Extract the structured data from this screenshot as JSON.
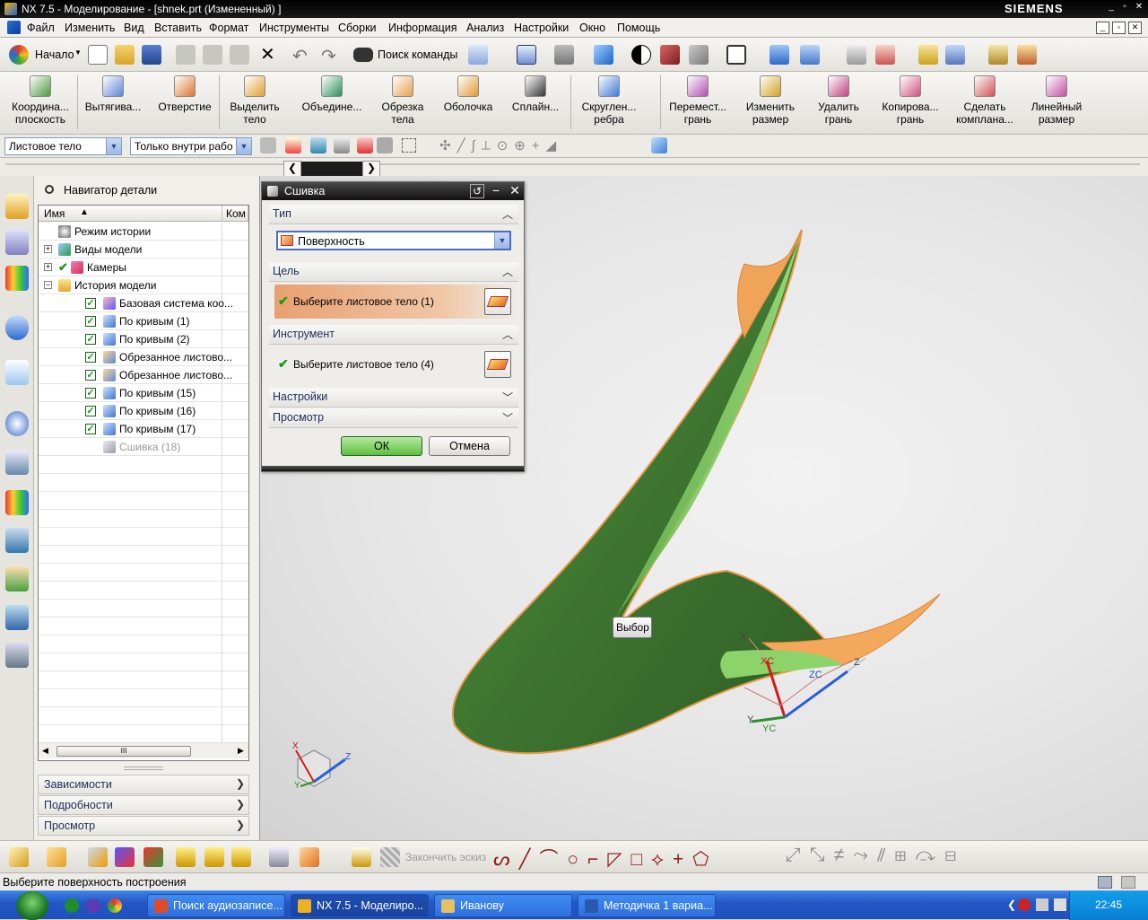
{
  "window": {
    "title": "NX 7.5 - Моделирование - [shnek.prt (Измененный) ]",
    "brand": "SIEMENS"
  },
  "menu": [
    "Файл",
    "Изменить",
    "Вид",
    "Вставить",
    "Формат",
    "Инструменты",
    "Сборки",
    "Информация",
    "Анализ",
    "Настройки",
    "Окно",
    "Помощь"
  ],
  "toolbar1": {
    "start_label": "Начало",
    "find_command_label": "Поиск команды"
  },
  "toolbar2": [
    {
      "line1": "Координа...",
      "line2": "плоскость",
      "icon": "datum-plane-icon",
      "color": "#4a9a3a"
    },
    {
      "line1": "Вытягива...",
      "line2": "",
      "icon": "extrude-icon",
      "color": "#5f84d6"
    },
    {
      "line1": "Отверстие",
      "line2": "",
      "icon": "hole-icon",
      "color": "#d9772a"
    },
    {
      "line1": "Выделить",
      "line2": "тело",
      "icon": "extract-body-icon",
      "color": "#e0a030"
    },
    {
      "line1": "Объедине...",
      "line2": "",
      "icon": "unite-icon",
      "color": "#2a8f5a"
    },
    {
      "line1": "Обрезка",
      "line2": "тела",
      "icon": "trim-body-icon",
      "color": "#e8a050"
    },
    {
      "line1": "Оболочка",
      "line2": "",
      "icon": "shell-icon",
      "color": "#e09a30"
    },
    {
      "line1": "Сплайн...",
      "line2": "",
      "icon": "spline-icon",
      "color": "#333333"
    },
    {
      "line1": "Скруглен...",
      "line2": "ребра",
      "icon": "edge-blend-icon",
      "color": "#3a78d6"
    },
    {
      "line1": "Перемест...",
      "line2": "грань",
      "icon": "move-face-icon",
      "color": "#b04fb0"
    },
    {
      "line1": "Изменить",
      "line2": "размер",
      "icon": "resize-face-icon",
      "color": "#d2a020"
    },
    {
      "line1": "Удалить",
      "line2": "грань",
      "icon": "delete-face-icon",
      "color": "#c04080"
    },
    {
      "line1": "Копирова...",
      "line2": "грань",
      "icon": "copy-face-icon",
      "color": "#d05080"
    },
    {
      "line1": "Сделать",
      "line2": "компланa...",
      "icon": "make-coplanar-icon",
      "color": "#d05050"
    },
    {
      "line1": "Линейный",
      "line2": "размер",
      "icon": "linear-dimension-icon",
      "color": "#c04fa0"
    }
  ],
  "selection_bar": {
    "type_filter": "Листовое тело",
    "scope_filter": "Только внутри рабо"
  },
  "part_navigator": {
    "title": "Навигатор детали",
    "col_name": "Имя",
    "col_comment": "Ком",
    "nodes": [
      {
        "label": "Режим истории",
        "level": 0,
        "check": false,
        "expander": "",
        "icon": "clock-icon",
        "grey": false
      },
      {
        "label": "Виды модели",
        "level": 0,
        "check": false,
        "expander": "+",
        "icon": "model-views-icon",
        "grey": false
      },
      {
        "label": "Камеры",
        "level": 0,
        "check": true,
        "expander": "+",
        "icon": "cameras-icon",
        "grey": false
      },
      {
        "label": "История модели",
        "level": 0,
        "check": false,
        "expander": "−",
        "icon": "folder-icon",
        "grey": false
      },
      {
        "label": "Базовая система коо...",
        "level": 1,
        "check": true,
        "expander": "",
        "icon": "datum-csys-icon",
        "grey": false
      },
      {
        "label": "По кривым (1)",
        "level": 1,
        "check": true,
        "expander": "",
        "icon": "through-curves-icon",
        "grey": false
      },
      {
        "label": "По кривым (2)",
        "level": 1,
        "check": true,
        "expander": "",
        "icon": "through-curves-icon",
        "grey": false
      },
      {
        "label": "Обрезанное листово...",
        "level": 1,
        "check": true,
        "expander": "",
        "icon": "trimmed-sheet-icon",
        "grey": false
      },
      {
        "label": "Обрезанное листово...",
        "level": 1,
        "check": true,
        "expander": "",
        "icon": "trimmed-sheet-icon",
        "grey": false
      },
      {
        "label": "По кривым (15)",
        "level": 1,
        "check": true,
        "expander": "",
        "icon": "through-curves-icon",
        "grey": false
      },
      {
        "label": "По кривым (16)",
        "level": 1,
        "check": true,
        "expander": "",
        "icon": "through-curves-icon",
        "grey": false
      },
      {
        "label": "По кривым (17)",
        "level": 1,
        "check": true,
        "expander": "",
        "icon": "through-curves-icon",
        "grey": false
      },
      {
        "label": "Сшивка (18)",
        "level": 1,
        "check": false,
        "expander": "",
        "icon": "sew-icon",
        "grey": true
      }
    ],
    "sections": [
      "Зависимости",
      "Подробности",
      "Просмотр"
    ]
  },
  "sew_dialog": {
    "title": "Сшивка",
    "section_type": "Тип",
    "type_value": "Поверхность",
    "section_target": "Цель",
    "target_prompt": "Выберите листовое тело (1)",
    "section_tool": "Инструмент",
    "tool_prompt": "Выберите листовое тело (4)",
    "section_settings": "Настройки",
    "section_preview": "Просмотр",
    "ok": "ОК",
    "cancel": "Отмена"
  },
  "viewport": {
    "tooltip": "Выбор",
    "wcs_labels": {
      "x": "X",
      "xc": "XC",
      "zc": "ZC",
      "z": "Z",
      "y": "Y",
      "yc": "YC"
    },
    "triad_labels": {
      "x": "X",
      "y": "Y",
      "z": "Z"
    },
    "colors": {
      "surface": "#3f7a33",
      "surface_light": "#8fd56a",
      "edge": "#f0a050"
    }
  },
  "bottom_toolbar": {
    "finish_sketch": "Закончить эскиз"
  },
  "status_text": "Выберите поверхность построения",
  "taskbar": {
    "items": [
      {
        "label": "Поиск аудиозаписе...",
        "active": false,
        "icon_color": "#e04a2a"
      },
      {
        "label": "NX 7.5 - Моделиро...",
        "active": true,
        "icon_color": "#f0b020"
      },
      {
        "label": "Иванову",
        "active": false,
        "icon_color": "#e8c060"
      },
      {
        "label": "Методичка 1 вариа...",
        "active": false,
        "icon_color": "#2a5ab0"
      }
    ],
    "clock": "22:45"
  }
}
